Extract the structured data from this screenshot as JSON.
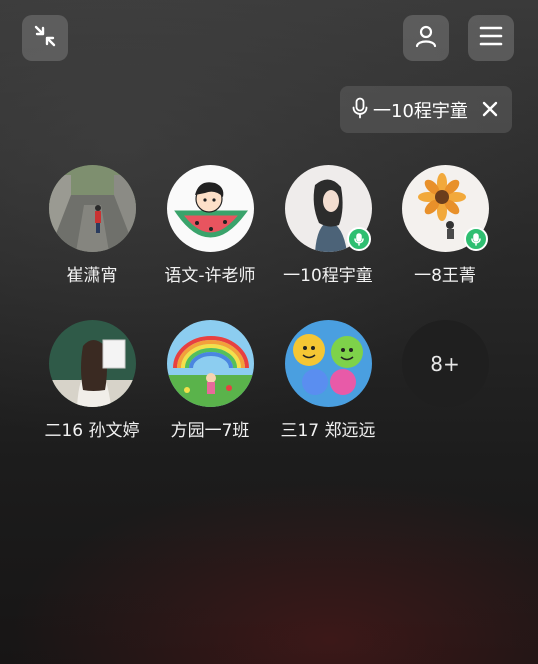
{
  "toolbar": {
    "collapse_icon": "collapse-arrows-icon",
    "profile_icon": "person-icon",
    "menu_icon": "hamburger-menu-icon"
  },
  "speaker": {
    "icon": "microphone-icon",
    "name": "一10程宇童",
    "close_icon": "close-icon"
  },
  "members": [
    {
      "name": "崔潇宵",
      "speaking": false
    },
    {
      "name": "语文-许老师",
      "speaking": false
    },
    {
      "name": "一10程宇童",
      "speaking": true
    },
    {
      "name": "一8王菁",
      "speaking": true
    },
    {
      "name": "二16 孙文婷",
      "speaking": false
    },
    {
      "name": "方园一7班",
      "speaking": false
    },
    {
      "name": "三17 郑远远",
      "speaking": false
    }
  ],
  "more": {
    "label": "8+"
  },
  "colors": {
    "mic_badge": "#2fbf71",
    "button_bg": "#6e6e6e"
  }
}
